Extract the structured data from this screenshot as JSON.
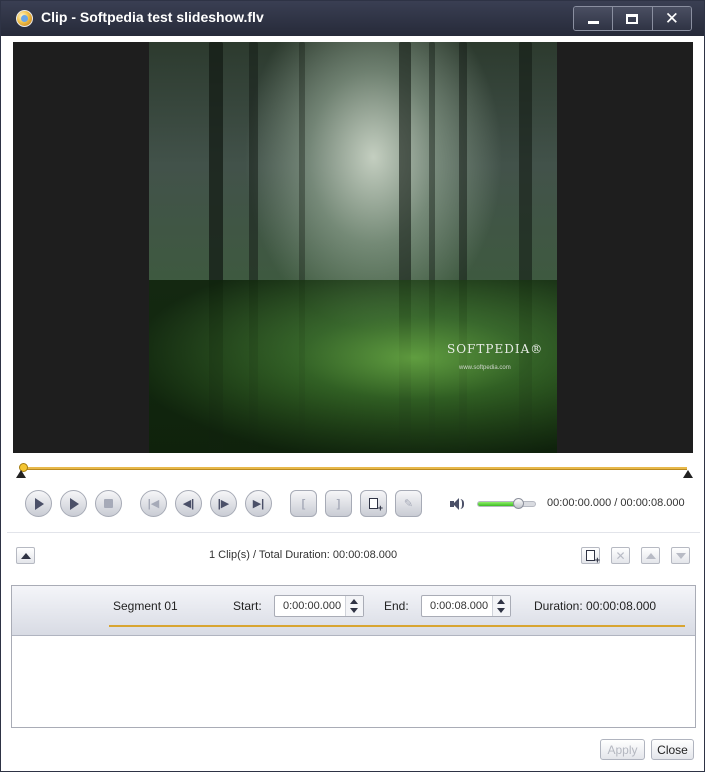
{
  "window": {
    "title": "Clip - Softpedia test slideshow.flv"
  },
  "video": {
    "brand_text": "SOFTPEDIA®",
    "brand_url": "www.softpedia.com"
  },
  "playback": {
    "position_fraction": 0.0,
    "volume_fraction": 0.7,
    "time_display": "00:00:00.000 / 00:00:08.000",
    "mark_in_label": "[",
    "mark_out_label": "]"
  },
  "clips": {
    "summary": "1 Clip(s) /  Total Duration: 00:00:08.000"
  },
  "segment": {
    "name": "Segment 01",
    "start_label": "Start:",
    "start_value": "0:00:00.000",
    "end_label": "End:",
    "end_value": "0:00:08.000",
    "duration_text": "Duration: 00:00:08.000"
  },
  "buttons": {
    "apply": "Apply",
    "close": "Close"
  }
}
